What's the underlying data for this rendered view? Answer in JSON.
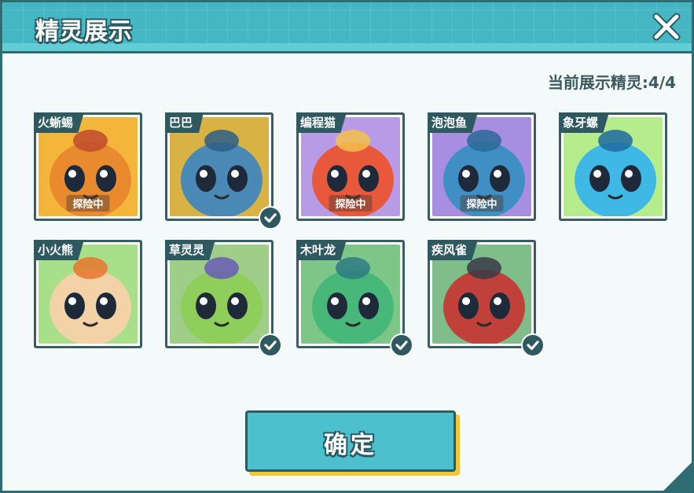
{
  "dialog": {
    "title": "精灵展示",
    "display_count": "当前展示精灵:4/4"
  },
  "pets": [
    {
      "name": "火蜥蜴",
      "status": "探险中",
      "selected": false,
      "bg": "#f3b53a",
      "body": "#e98a2e",
      "accent": "#c04a2e"
    },
    {
      "name": "巴巴",
      "status": "",
      "selected": true,
      "bg": "#d8b344",
      "body": "#4a88b5",
      "accent": "#2d5f85"
    },
    {
      "name": "编程猫",
      "status": "探险中",
      "selected": false,
      "bg": "#b89be6",
      "body": "#e8583b",
      "accent": "#f2c14a"
    },
    {
      "name": "泡泡鱼",
      "status": "探险中",
      "selected": false,
      "bg": "#a88ee0",
      "body": "#3f8fc4",
      "accent": "#2a6a98"
    },
    {
      "name": "象牙螺",
      "status": "",
      "selected": false,
      "bg": "#b5ec8c",
      "body": "#3fb8e6",
      "accent": "#1e6aa0"
    },
    {
      "name": "小火熊",
      "status": "",
      "selected": false,
      "bg": "#a8e08a",
      "body": "#f3d2a8",
      "accent": "#e8742e"
    },
    {
      "name": "草灵灵",
      "status": "",
      "selected": true,
      "bg": "#9fce88",
      "body": "#8fce5a",
      "accent": "#6a5ab8"
    },
    {
      "name": "木叶龙",
      "status": "",
      "selected": true,
      "bg": "#7cc688",
      "body": "#48b87a",
      "accent": "#2e7a84"
    },
    {
      "name": "疾风雀",
      "status": "",
      "selected": true,
      "bg": "#7fbd8a",
      "body": "#c0403a",
      "accent": "#3a3a44"
    }
  ],
  "confirm_label": "确定"
}
